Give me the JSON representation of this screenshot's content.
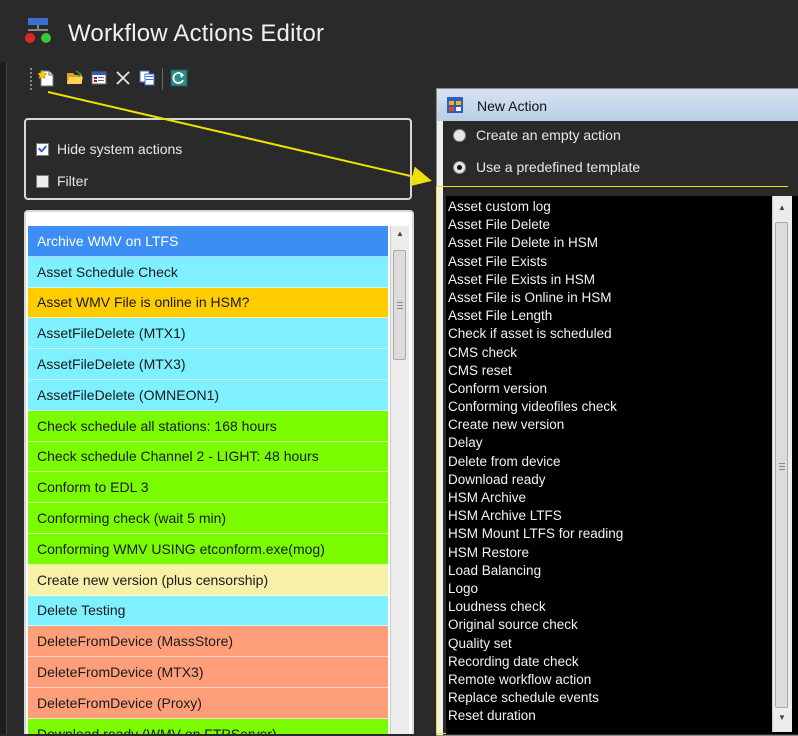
{
  "app": {
    "title": "Workflow Actions Editor",
    "icon": "workflow-app-icon"
  },
  "toolbar": {
    "buttons": [
      {
        "name": "new-action-button",
        "icon": "new-document-icon"
      },
      {
        "name": "open-button",
        "icon": "folder-open-icon"
      },
      {
        "name": "properties-button",
        "icon": "properties-icon"
      },
      {
        "name": "delete-button",
        "icon": "x-delete-icon"
      },
      {
        "name": "copy-button",
        "icon": "copy-icon"
      },
      {
        "name": "refresh-button",
        "icon": "refresh-icon"
      }
    ]
  },
  "options": {
    "hide_system_actions": {
      "label": "Hide system actions",
      "checked": true
    },
    "filter": {
      "label": "Filter",
      "checked": false
    }
  },
  "actions": {
    "items": [
      {
        "label": "Archive WMV on LTFS",
        "color": "#3c8ef5",
        "selected": true
      },
      {
        "label": "Asset Schedule Check",
        "color": "#7ff0ff"
      },
      {
        "label": "Asset WMV File is online in HSM?",
        "color": "#ffcc00"
      },
      {
        "label": "AssetFileDelete (MTX1)",
        "color": "#7ff0ff"
      },
      {
        "label": "AssetFileDelete (MTX3)",
        "color": "#7ff0ff"
      },
      {
        "label": "AssetFileDelete (OMNEON1)",
        "color": "#7ff0ff"
      },
      {
        "label": "Check schedule all stations: 168 hours",
        "color": "#7cfc00"
      },
      {
        "label": "Check schedule Channel 2 - LIGHT: 48 hours",
        "color": "#7cfc00"
      },
      {
        "label": "Conform to EDL 3",
        "color": "#7cfc00"
      },
      {
        "label": "Conforming check (wait 5 min)",
        "color": "#7cfc00"
      },
      {
        "label": "Conforming WMV USING etconform.exe(mog)",
        "color": "#7cfc00"
      },
      {
        "label": "Create new version (plus censorship)",
        "color": "#f6f0a8"
      },
      {
        "label": "Delete Testing",
        "color": "#7ff0ff"
      },
      {
        "label": "DeleteFromDevice (MassStore)",
        "color": "#ff9f7a"
      },
      {
        "label": "DeleteFromDevice (MTX3)",
        "color": "#ff9f7a"
      },
      {
        "label": "DeleteFromDevice (Proxy)",
        "color": "#ff9f7a"
      },
      {
        "label": "Download ready (WMV on FTPServer)",
        "color": "#7cfc00"
      }
    ]
  },
  "dialog": {
    "title": "New Action",
    "icon": "window-icon",
    "options": {
      "empty": {
        "label": "Create an empty action",
        "checked": false
      },
      "template": {
        "label": "Use a predefined template",
        "checked": true
      }
    },
    "templates": [
      "Asset custom log",
      "Asset File Delete",
      "Asset File Delete in HSM",
      "Asset File Exists",
      "Asset File Exists in HSM",
      "Asset File is Online in HSM",
      "Asset File Length",
      "Check if asset is scheduled",
      "CMS check",
      "CMS reset",
      "Conform version",
      "Conforming videofiles check",
      "Create new version",
      "Delay",
      "Delete from device",
      "Download ready",
      "HSM Archive",
      "HSM Archive LTFS",
      "HSM Mount LTFS for reading",
      "HSM Restore",
      "Load Balancing",
      "Logo",
      "Loudness check",
      "Original source check",
      "Quality set",
      "Recording date check",
      "Remote workflow action",
      "Replace schedule events",
      "Reset duration"
    ]
  },
  "colors": {
    "annotation_arrow": "#f0e000",
    "dialog_title_gradient_top": "#d7e3f1"
  }
}
